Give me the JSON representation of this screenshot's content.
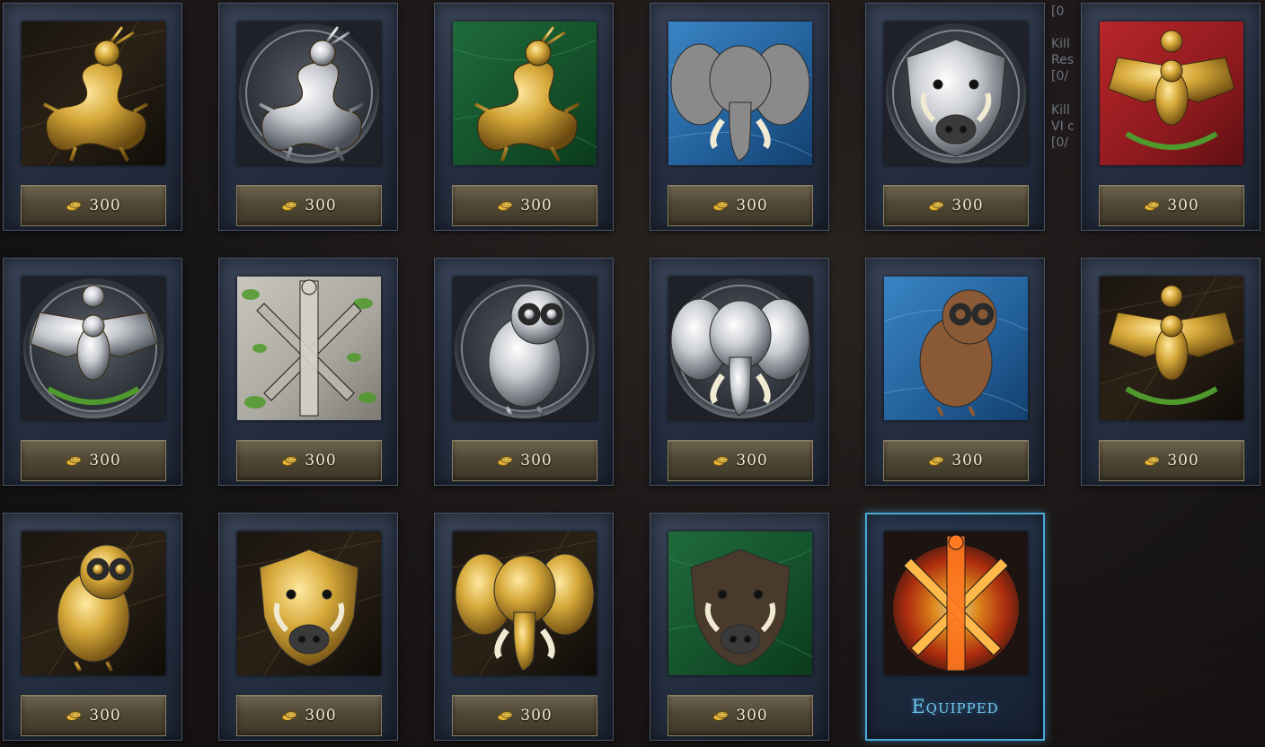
{
  "coin_icon": "gold-coins-icon",
  "cards": [
    {
      "emblem": "gold-dragon",
      "price": "300"
    },
    {
      "emblem": "silver-dragon",
      "price": "300"
    },
    {
      "emblem": "dragon-on-jade",
      "price": "300"
    },
    {
      "emblem": "elephant-on-sapphire",
      "price": "300"
    },
    {
      "emblem": "silver-boar",
      "price": "300"
    },
    {
      "emblem": "gold-eagle-on-crimson",
      "price": "300"
    },
    {
      "emblem": "silver-eagle",
      "price": "300"
    },
    {
      "emblem": "stone-swords-in-ivy",
      "price": "300"
    },
    {
      "emblem": "silver-owl",
      "price": "300"
    },
    {
      "emblem": "silver-elephant",
      "price": "300"
    },
    {
      "emblem": "owl-on-sapphire",
      "price": "300"
    },
    {
      "emblem": "gold-eagle-on-marble",
      "price": "300"
    },
    {
      "emblem": "gold-owl-on-marble",
      "price": "300"
    },
    {
      "emblem": "gold-boar",
      "price": "300"
    },
    {
      "emblem": "gold-elephant",
      "price": "300"
    },
    {
      "emblem": "boar-on-jade",
      "price": "300"
    },
    {
      "emblem": "flaming-swords",
      "status": "Equipped"
    }
  ],
  "side_panel": {
    "lines": [
      "[0",
      "Kill",
      "Res",
      "[0/",
      "Kill",
      "VI c",
      "[0/"
    ]
  },
  "colors": {
    "gold": "#d6a93a",
    "silver": "#c9ccd1",
    "equipped_accent": "#49a9d8",
    "price_text": "#f1ead2"
  }
}
